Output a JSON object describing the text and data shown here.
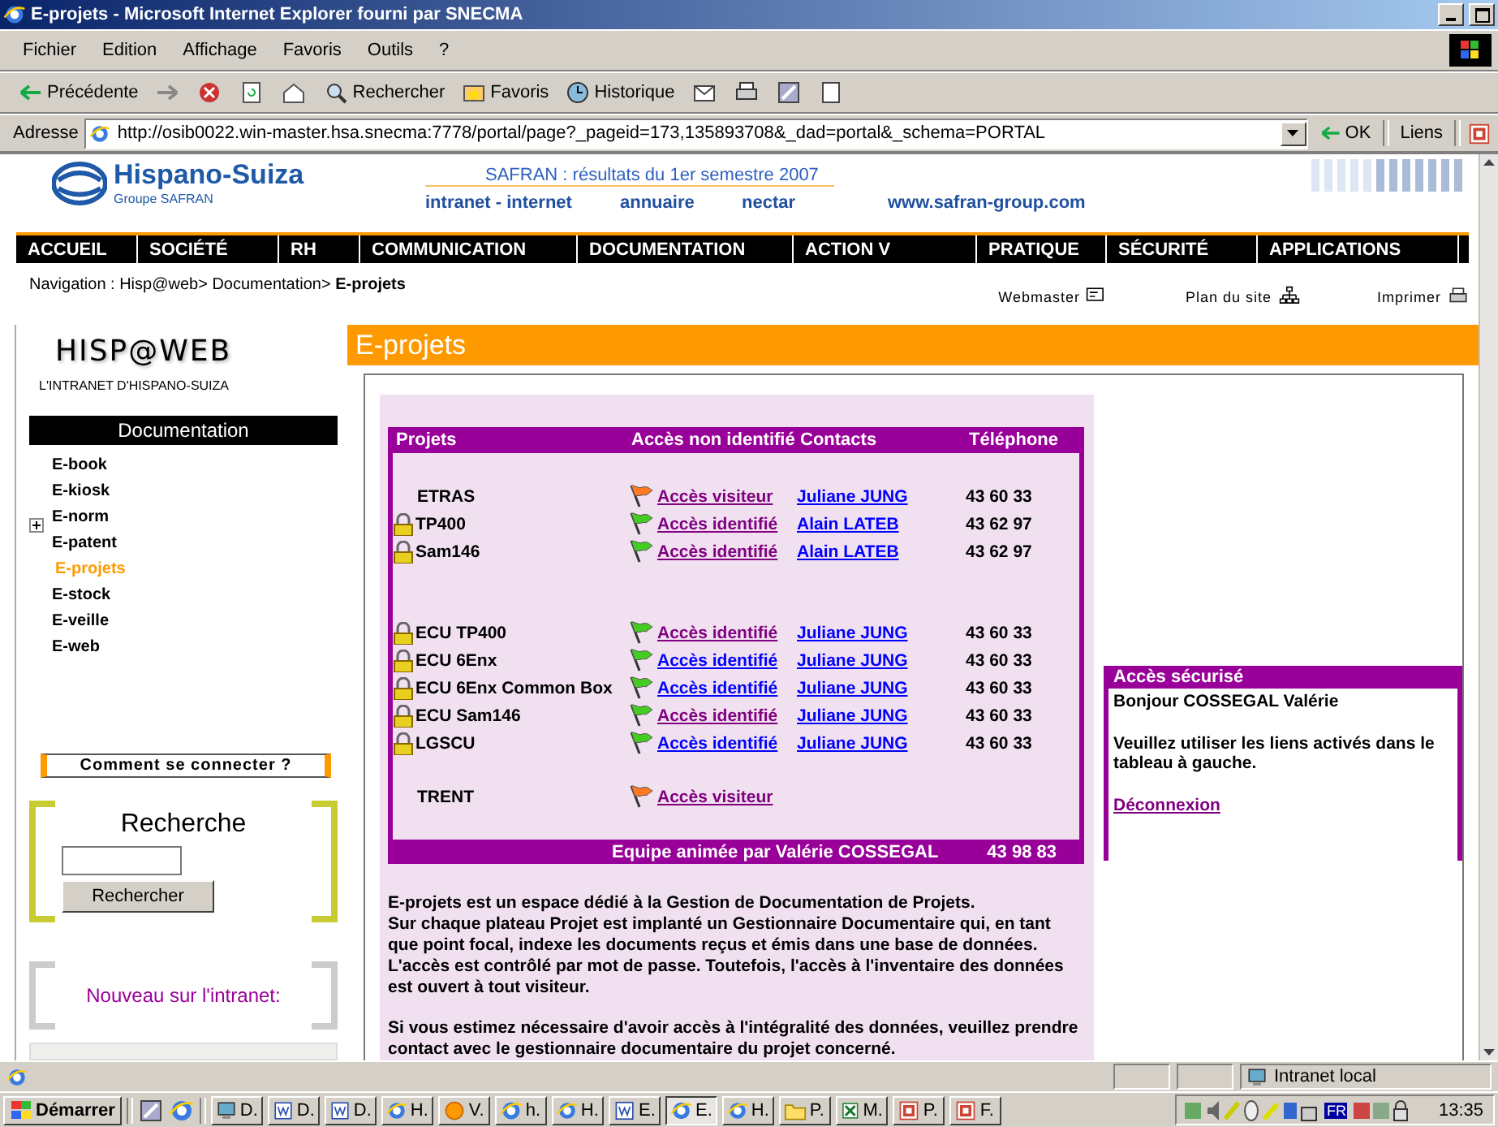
{
  "window": {
    "title": "E-projets - Microsoft Internet Explorer fourni par SNECMA"
  },
  "menu": [
    "Fichier",
    "Edition",
    "Affichage",
    "Favoris",
    "Outils",
    "?"
  ],
  "toolbar": [
    {
      "kind": "back",
      "label": "Précédente"
    },
    {
      "kind": "forward"
    },
    {
      "kind": "stop"
    },
    {
      "kind": "refresh"
    },
    {
      "kind": "home"
    },
    {
      "kind": "search",
      "label": "Rechercher"
    },
    {
      "kind": "favorites",
      "label": "Favoris"
    },
    {
      "kind": "history",
      "label": "Historique"
    },
    {
      "kind": "mail"
    },
    {
      "kind": "print"
    },
    {
      "kind": "edit"
    },
    {
      "kind": "discuss"
    }
  ],
  "address": {
    "label": "Adresse",
    "value": "http://osib0022.win-master.hsa.snecma:7778/portal/page?_pageid=173,135893708&_dad=portal&_schema=PORTAL",
    "go": "OK",
    "links": "Liens"
  },
  "header": {
    "brand": "Hispano-Suiza",
    "group": "Groupe SAFRAN",
    "headline": "SAFRAN : résultats du 1er semestre 2007",
    "links": [
      "intranet - internet",
      "annuaire",
      "nectar",
      "www.safran-group.com"
    ]
  },
  "nav": [
    "ACCUEIL",
    "SOCIÉTÉ",
    "RH",
    "COMMUNICATION",
    "DOCUMENTATION",
    "ACTION V",
    "PRATIQUE",
    "SÉCURITÉ",
    "APPLICATIONS"
  ],
  "breadcrumb": "Navigation : Hisp@web> Documentation> **E-projets**",
  "tools": [
    {
      "kind": "webmaster",
      "label": "Webmaster"
    },
    {
      "kind": "sitemap",
      "label": "Plan du site"
    },
    {
      "kind": "print",
      "label": "Imprimer"
    }
  ],
  "sidebar": {
    "logo": "HISP@WEB",
    "tagline": "L'INTRANET D'HISPANO-SUIZA",
    "section": "Documentation",
    "items": [
      {
        "label": "E-book",
        "selected": false,
        "expandable": false
      },
      {
        "label": "E-kiosk",
        "selected": false,
        "expandable": false
      },
      {
        "label": "E-norm",
        "selected": false,
        "expandable": true
      },
      {
        "label": "E-patent",
        "selected": false,
        "expandable": false
      },
      {
        "label": "E-projets",
        "selected": true,
        "expandable": false
      },
      {
        "label": "E-stock",
        "selected": false,
        "expandable": false
      },
      {
        "label": "E-veille",
        "selected": false,
        "expandable": false
      },
      {
        "label": "E-web",
        "selected": false,
        "expandable": false
      }
    ],
    "connect": "Comment se connecter ?",
    "search": {
      "title": "Recherche",
      "button": "Rechercher"
    },
    "news": "Nouveau sur l'intranet:"
  },
  "page_title": "E-projets",
  "table": {
    "columns": [
      "Projets",
      "Accès non identifié",
      "Contacts",
      "Téléphone"
    ],
    "groups": [
      [
        {
          "project": "ETRAS",
          "locked": false,
          "access": {
            "kind": "visitor",
            "label": "Accès visiteur",
            "visited": true
          },
          "contact": "Juliane JUNG",
          "phone": "43 60 33"
        },
        {
          "project": "TP400",
          "locked": true,
          "access": {
            "kind": "identified",
            "label": "Accès identifié",
            "visited": true
          },
          "contact": "Alain LATEB",
          "phone": "43 62 97"
        },
        {
          "project": "Sam146",
          "locked": true,
          "access": {
            "kind": "identified",
            "label": "Accès identifié",
            "visited": true
          },
          "contact": "Alain LATEB",
          "phone": "43 62 97"
        }
      ],
      [
        {
          "project": "ECU TP400",
          "locked": true,
          "access": {
            "kind": "identified",
            "label": "Accès identifié",
            "visited": true
          },
          "contact": "Juliane JUNG",
          "phone": "43 60 33"
        },
        {
          "project": "ECU 6Enx",
          "locked": true,
          "access": {
            "kind": "identified",
            "label": "Accès identifié",
            "visited": false
          },
          "contact": "Juliane JUNG",
          "phone": "43 60 33"
        },
        {
          "project": "ECU 6Enx Common Box",
          "locked": true,
          "access": {
            "kind": "identified",
            "label": "Accès identifié",
            "visited": false
          },
          "contact": "Juliane JUNG",
          "phone": "43 60 33"
        },
        {
          "project": "ECU Sam146",
          "locked": true,
          "access": {
            "kind": "identified",
            "label": "Accès identifié",
            "visited": true
          },
          "contact": "Juliane JUNG",
          "phone": "43 60 33"
        },
        {
          "project": "LGSCU",
          "locked": true,
          "access": {
            "kind": "identified",
            "label": "Accès identifié",
            "visited": false
          },
          "contact": "Juliane JUNG",
          "phone": "43 60 33"
        }
      ],
      [
        {
          "project": "TRENT",
          "locked": false,
          "access": {
            "kind": "visitor",
            "label": "Accès visiteur",
            "visited": true
          }
        }
      ]
    ],
    "footer": {
      "team": "Equipe animée par Valérie COSSEGAL",
      "phone": "43 98 83"
    }
  },
  "intro": [
    [
      "E-projets est un espace dédié à la Gestion de Documentation de Projets.",
      "Sur chaque plateau Projet est implanté un Gestionnaire Documentaire qui, en tant que point focal, indexe les documents reçus et émis dans une base de données. L'accès est contrôlé par mot de passe. Toutefois, l'accès à l'inventaire des données est ouvert à tout visiteur."
    ],
    [
      "Si vous estimez nécessaire d'avoir accès à l'intégralité des données, veuillez prendre contact avec le gestionnaire documentaire du projet concerné."
    ]
  ],
  "secure": {
    "title": "Accès sécurisé",
    "greeting": "Bonjour COSSEGAL Valérie",
    "message": "Veuillez utiliser les liens activés dans le tableau à gauche.",
    "logout": "Déconnexion"
  },
  "status": {
    "zone": "Intranet local"
  },
  "taskbar": {
    "start": "Démarrer",
    "items": [
      {
        "kind": "computer",
        "label": "D.",
        "selected": false
      },
      {
        "kind": "word",
        "label": "D.",
        "selected": false
      },
      {
        "kind": "word",
        "label": "D.",
        "selected": false
      },
      {
        "kind": "ie",
        "label": "H.",
        "selected": false
      },
      {
        "kind": "sun",
        "label": "V.",
        "selected": false
      },
      {
        "kind": "ie",
        "label": "h.",
        "selected": false
      },
      {
        "kind": "ie",
        "label": "H.",
        "selected": false
      },
      {
        "kind": "word",
        "label": "E.",
        "selected": false
      },
      {
        "kind": "ie",
        "label": "E.",
        "selected": true
      },
      {
        "kind": "ie",
        "label": "H.",
        "selected": false
      },
      {
        "kind": "folder",
        "label": "P.",
        "selected": false
      },
      {
        "kind": "excel",
        "label": "M.",
        "selected": false
      },
      {
        "kind": "ppt",
        "label": "P.",
        "selected": false
      },
      {
        "kind": "ppt",
        "label": "F.",
        "selected": false
      }
    ],
    "lang": "FR",
    "time": "13:35"
  }
}
